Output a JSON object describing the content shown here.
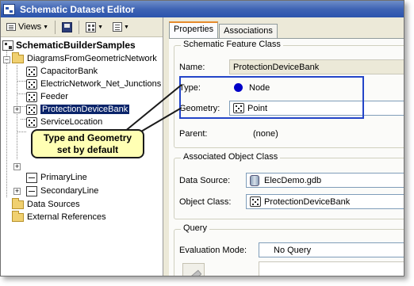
{
  "window": {
    "title": "Schematic Dataset Editor"
  },
  "toolbar": {
    "views_label": "Views"
  },
  "tree": {
    "root": "SchematicBuilderSamples",
    "group": "DiagramsFromGeometricNetwork",
    "items": [
      "CapacitorBank",
      "ElectricNetwork_Net_Junctions",
      "Feeder",
      "ProtectionDeviceBank",
      "ServiceLocation"
    ],
    "lines": [
      "PrimaryLine",
      "SecondaryLine"
    ],
    "folders": [
      "Data Sources",
      "External References"
    ]
  },
  "callout": {
    "line1": "Type and Geometry",
    "line2": "set by default"
  },
  "tabs": [
    "Properties",
    "Associations"
  ],
  "feature_class": {
    "group_title": "Schematic Feature Class",
    "name_label": "Name:",
    "name_value": "ProtectionDeviceBank",
    "type_label": "Type:",
    "type_value": "Node",
    "geometry_label": "Geometry:",
    "geometry_value": "Point",
    "parent_label": "Parent:",
    "parent_value": "(none)"
  },
  "object_class": {
    "group_title": "Associated Object Class",
    "source_label": "Data Source:",
    "source_value": "ElecDemo.gdb",
    "class_label": "Object Class:",
    "class_value": "ProtectionDeviceBank"
  },
  "query": {
    "group_title": "Query",
    "mode_label": "Evaluation Mode:",
    "mode_value": "No Query"
  },
  "colors": {
    "title_bar": "#2b54ad",
    "highlight": "#2345c8",
    "selection": "#0a246a",
    "callout_bg": "#ffffb4",
    "node_dot": "#0000c8"
  }
}
